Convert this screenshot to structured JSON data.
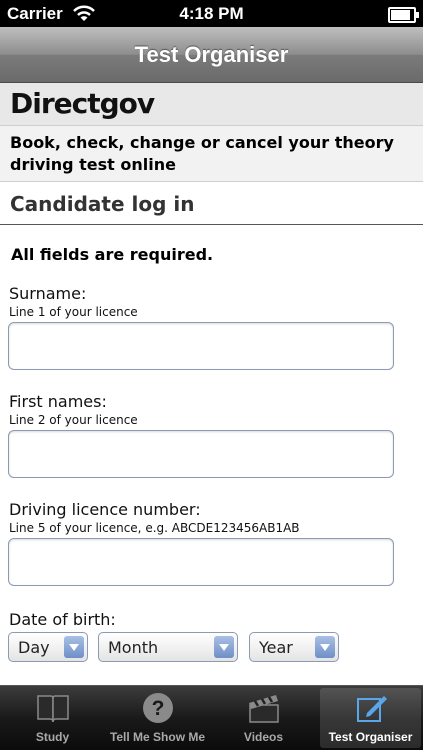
{
  "status_bar": {
    "carrier": "Carrier",
    "time": "4:18 PM",
    "battery_level": 0.95
  },
  "nav": {
    "title": "Test Organiser"
  },
  "brand": {
    "name": "Directgov"
  },
  "intro": {
    "text": "Book, check, change or cancel your theory driving test online"
  },
  "login": {
    "heading": "Candidate log in",
    "required_note": "All fields are required."
  },
  "fields": [
    {
      "label": "Surname:",
      "help": "Line 1 of your licence",
      "value": ""
    },
    {
      "label": "First names:",
      "help": "Line 2 of your licence",
      "value": ""
    },
    {
      "label": "Driving licence number:",
      "help": "Line 5 of your licence, e.g. ABCDE123456AB1AB",
      "value": ""
    }
  ],
  "dob": {
    "label": "Date of birth:",
    "day": "Day",
    "month": "Month",
    "year": "Year"
  },
  "tabs": [
    {
      "label": "Study",
      "icon": "book-icon"
    },
    {
      "label": "Tell Me Show Me",
      "icon": "question-icon"
    },
    {
      "label": "Videos",
      "icon": "clapperboard-icon"
    },
    {
      "label": "Test Organiser",
      "icon": "edit-icon",
      "active": true
    }
  ],
  "colors": {
    "tab_active": "#ffffff",
    "tab_inactive": "#a9a9a9",
    "input_border": "#8a9bb3"
  }
}
